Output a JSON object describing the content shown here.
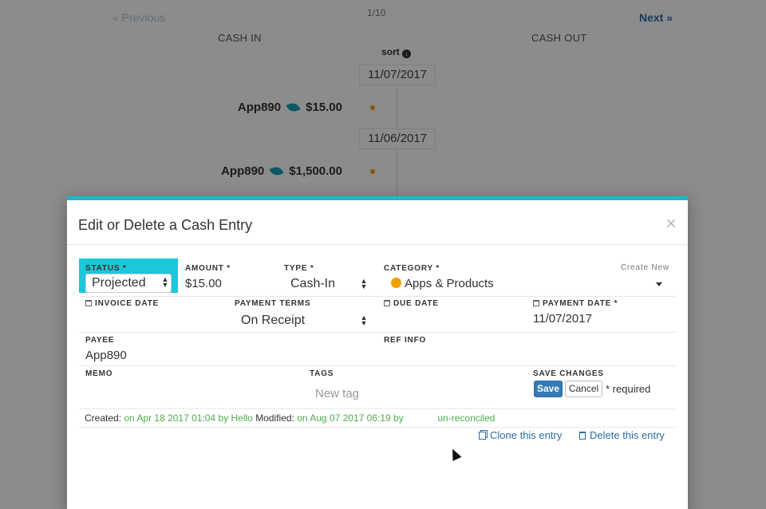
{
  "background": {
    "pager": {
      "previous": "« Previous",
      "count": "1/10",
      "next": "Next »"
    },
    "columns": {
      "cash_in": "CASH IN",
      "cash_out": "CASH OUT"
    },
    "sort_label": "sort",
    "groups": [
      {
        "date": "11/07/2017",
        "payee": "App890",
        "amount": "$15.00"
      },
      {
        "date": "11/06/2017",
        "payee": "App890",
        "amount": "$1,500.00"
      }
    ]
  },
  "modal": {
    "title": "Edit or Delete a Cash Entry",
    "close_glyph": "×",
    "status": {
      "label": "STATUS *",
      "value": "Projected"
    },
    "amount": {
      "label": "AMOUNT *",
      "value": "$15.00"
    },
    "type": {
      "label": "TYPE *",
      "value": "Cash-In"
    },
    "category": {
      "label": "CATEGORY *",
      "value": "Apps & Products",
      "create_new": "Create New"
    },
    "invoice_date": {
      "label": "INVOICE DATE",
      "value": ""
    },
    "payment_terms": {
      "label": "PAYMENT TERMS",
      "value": "On Receipt"
    },
    "due_date": {
      "label": "DUE DATE",
      "value": ""
    },
    "payment_date": {
      "label": "PAYMENT DATE *",
      "value": "11/07/2017"
    },
    "payee": {
      "label": "PAYEE",
      "value": "App890"
    },
    "ref_info": {
      "label": "REF INFO",
      "value": ""
    },
    "memo": {
      "label": "MEMO",
      "value": ""
    },
    "tags": {
      "label": "TAGS",
      "placeholder": "New tag"
    },
    "save_changes": {
      "label": "SAVE CHANGES",
      "save": "Save",
      "cancel": "Cancel",
      "required": "* required"
    },
    "meta": {
      "created_label": "Created:",
      "created_value": "on Apr 18 2017 01:04 by Hello",
      "modified_label": "Modified:",
      "modified_value": "on Aug 07 2017 06:19 by",
      "reconcile": "un-reconciled"
    },
    "actions": {
      "clone": "Clone this entry",
      "delete": "Delete this entry"
    }
  },
  "colors": {
    "accent": "#1bc7d8",
    "link": "#2e6da4",
    "category_dot": "#f0a000",
    "meta_green": "#4cae4c"
  }
}
